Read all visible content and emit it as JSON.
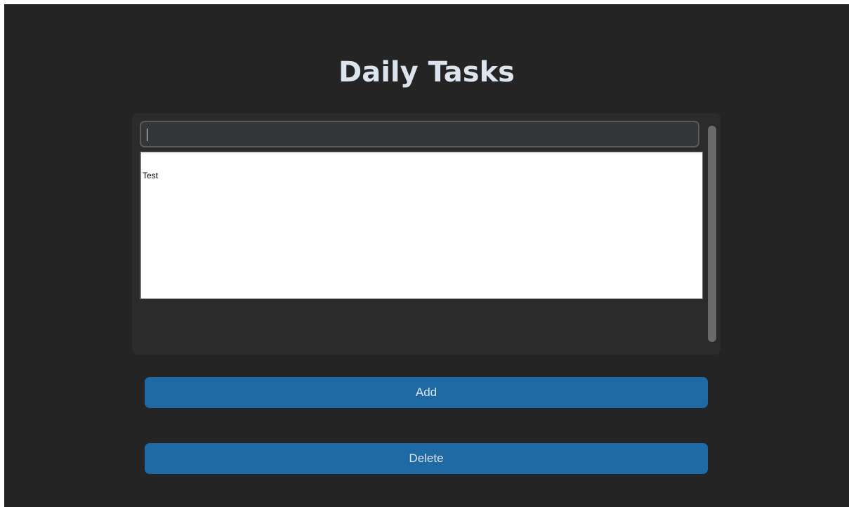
{
  "app": {
    "title": "Daily Tasks"
  },
  "task_entry": {
    "value": "",
    "placeholder": ""
  },
  "task_list": {
    "items": [
      "Test"
    ]
  },
  "buttons": {
    "add_label": "Add",
    "delete_label": "Delete"
  },
  "colors": {
    "background": "#242424",
    "frame": "#2b2b2b",
    "entry_bg": "#343638",
    "entry_border": "#565b5e",
    "button": "#1f6aa5",
    "text": "#dce4ee",
    "scrollbar": "#6a6a6a"
  }
}
